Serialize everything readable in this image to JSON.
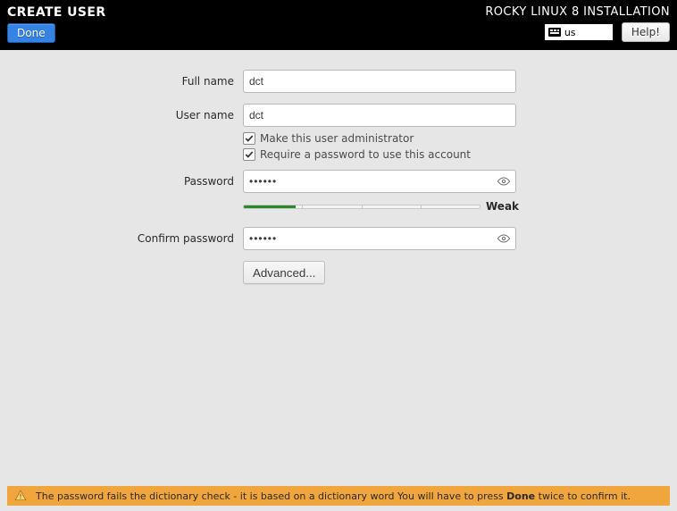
{
  "header": {
    "page_title": "CREATE USER",
    "product_title": "ROCKY LINUX 8 INSTALLATION",
    "done_label": "Done",
    "help_label": "Help!",
    "keyboard_layout": "us"
  },
  "form": {
    "full_name_label": "Full name",
    "full_name_value": "dct",
    "user_name_label": "User name",
    "user_name_value": "dct",
    "admin_checkbox_label": "Make this user administrator",
    "admin_checked": true,
    "require_pw_checkbox_label": "Require a password to use this account",
    "require_pw_checked": true,
    "password_label": "Password",
    "password_value": "••••••",
    "confirm_label": "Confirm password",
    "confirm_value": "••••••",
    "strength_label": "Weak",
    "strength_percent": 22,
    "advanced_label": "Advanced..."
  },
  "warning": {
    "prefix": "The password fails the dictionary check - it is based on a dictionary word You will have to press ",
    "bold_word": "Done",
    "suffix": " twice to confirm it."
  }
}
